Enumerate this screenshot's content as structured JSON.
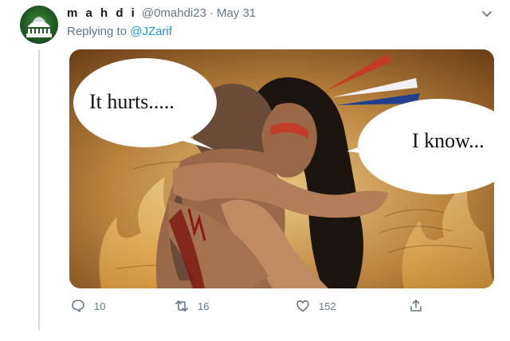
{
  "tweet": {
    "display_name": "m a h d i",
    "handle": "@0mahdi23",
    "separator": "·",
    "date": "May 31",
    "reply_prefix": "Replying to",
    "reply_mention": "@JZarif"
  },
  "image": {
    "left_bubble_text": "It hurts.....",
    "right_bubble_text": "I know..."
  },
  "actions": {
    "reply_count": "10",
    "retweet_count": "16",
    "like_count": "152"
  },
  "icons": {
    "avatar": "mosque-avatar-icon",
    "menu": "chevron-down-icon",
    "reply": "comment-icon",
    "retweet": "retweet-icon",
    "like": "heart-icon",
    "share": "share-icon"
  },
  "colors": {
    "link": "#1b95e0",
    "muted": "#657786",
    "thread_line": "#cfd9de"
  }
}
